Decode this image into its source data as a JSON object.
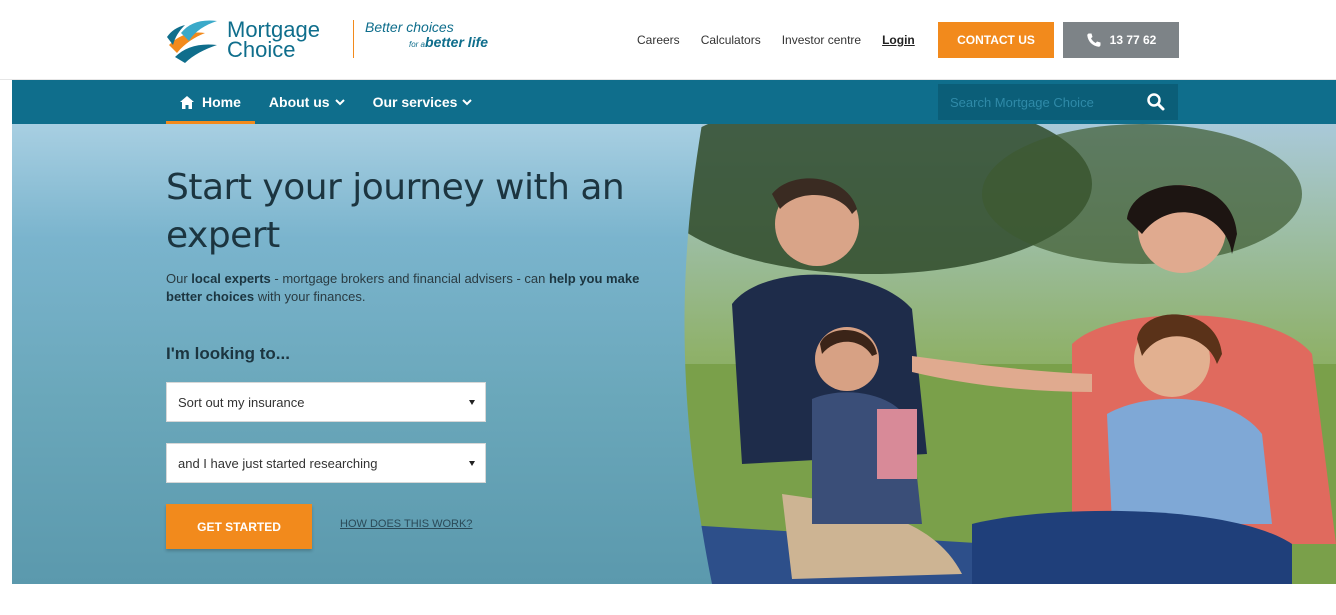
{
  "header": {
    "logo_line1": "Mortgage",
    "logo_line2": "Choice",
    "tagline_line1": "Better choices",
    "tagline_small": "for a",
    "tagline_line2": "better life",
    "links": [
      "Careers",
      "Calculators",
      "Investor centre"
    ],
    "login_label": "Login",
    "contact_label": "CONTACT US",
    "phone_label": "13 77 62"
  },
  "nav": {
    "items": [
      {
        "label": "Home",
        "icon": "home-icon"
      },
      {
        "label": "About us",
        "icon": "chevron-down-icon"
      },
      {
        "label": "Our services",
        "icon": "chevron-down-icon"
      }
    ],
    "search_placeholder": "Search Mortgage Choice"
  },
  "hero": {
    "title": "Start your journey with an expert",
    "desc_part1": "Our ",
    "desc_bold1": "local experts",
    "desc_part2": " - mortgage brokers and financial advisers - can ",
    "desc_bold2": "help you make better choices",
    "desc_part3": " with your finances.",
    "looking_label": "I'm looking to...",
    "select1_value": "Sort out my insurance",
    "select2_value": "and I have just started researching",
    "cta_label": "GET STARTED",
    "how_label": "HOW DOES THIS WORK?"
  },
  "colors": {
    "brand_teal": "#0f6e8c",
    "accent_orange": "#f28a1c",
    "phone_grey": "#7d8387"
  }
}
